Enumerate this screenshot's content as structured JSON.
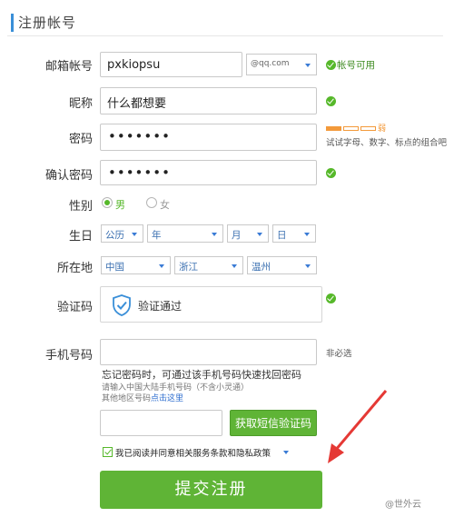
{
  "header": {
    "title": "注册帐号"
  },
  "email": {
    "label": "邮箱帐号",
    "value": "pxkiopsu",
    "domain": "@qq.com",
    "status": "帐号可用"
  },
  "nickname": {
    "label": "昵称",
    "value": "什么都想要"
  },
  "password": {
    "label": "密码",
    "value": "•••••••",
    "strength_glyph": "弱",
    "strength_hint": "试试字母、数字、标点的组合吧"
  },
  "confirm_password": {
    "label": "确认密码",
    "value": "•••••••"
  },
  "gender": {
    "label": "性别",
    "options": [
      "男",
      "女"
    ],
    "selected": "男"
  },
  "birthday": {
    "label": "生日",
    "calendar": "公历",
    "year": "年",
    "month": "月",
    "day": "日"
  },
  "location": {
    "label": "所在地",
    "country": "中国",
    "province": "浙江",
    "city": "温州"
  },
  "captcha": {
    "label": "验证码",
    "status": "验证通过"
  },
  "phone": {
    "label": "手机号码",
    "value": "",
    "optional": "非必选",
    "forgot_hint": "忘记密码时，可通过该手机号码快速找回密码",
    "china_hint": "请输入中国大陆手机号码（不含小灵通）",
    "other_prefix": "其他地区号码",
    "other_link": "点击这里"
  },
  "sms": {
    "value": "",
    "button": "获取短信验证码"
  },
  "agreement": {
    "label": "我已阅读并同意相关服务条款和隐私政策",
    "checked": true
  },
  "submit": {
    "label": "提交注册"
  },
  "watermark": "@世外云",
  "colors": {
    "accent_green": "#5fb436",
    "ok_green": "#56b82a",
    "link_blue": "#2c6ccf",
    "arrow_red": "#e53935",
    "header_accent": "#3a8fd8"
  },
  "icons": [
    "check-circle-icon",
    "shield-check-icon",
    "chevron-down-icon",
    "red-arrow-annotation"
  ]
}
